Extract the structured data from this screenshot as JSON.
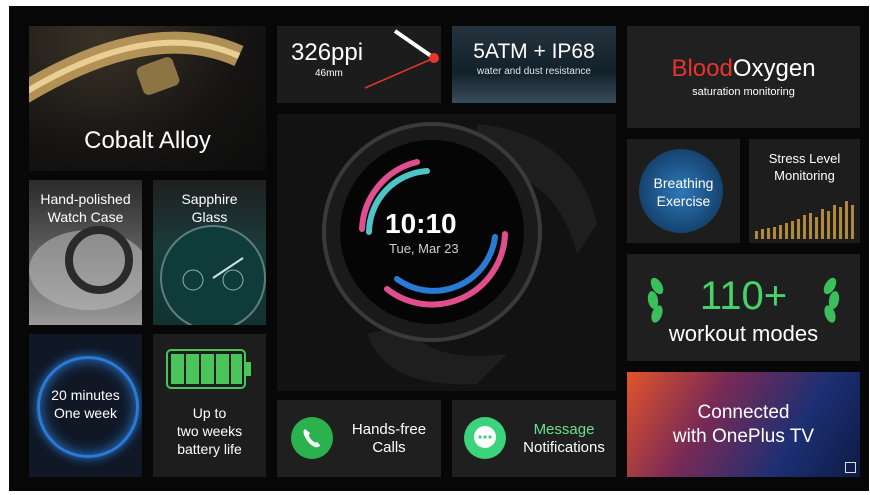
{
  "tiles": {
    "cobalt": "Cobalt Alloy",
    "ppi": {
      "value": "326ppi",
      "size": "46mm"
    },
    "atm": {
      "title": "5ATM + IP68",
      "subtitle": "water and dust resistance"
    },
    "blood": {
      "word1": "Blood",
      "word2": "Oxygen",
      "subtitle": "saturation monitoring"
    },
    "hand_polished": {
      "line1": "Hand-polished",
      "line2": "Watch Case"
    },
    "sapphire": {
      "line1": "Sapphire",
      "line2": "Glass"
    },
    "breathing": {
      "line1": "Breathing",
      "line2": "Exercise"
    },
    "stress": {
      "line1": "Stress Level",
      "line2": "Monitoring"
    },
    "workout": {
      "count": "110+",
      "label": "workout modes"
    },
    "charge": {
      "line1": "20 minutes",
      "line2": "One week"
    },
    "battery": {
      "line1": "Up to",
      "line2": "two weeks",
      "line3": "battery life"
    },
    "calls": {
      "line1": "Hands-free",
      "line2": "Calls"
    },
    "message": {
      "line1": "Message",
      "line2": "Notifications"
    },
    "tv": {
      "line1": "Connected",
      "line2": "with OnePlus TV"
    }
  },
  "watch": {
    "time": "10:10",
    "date": "Tue, Mar 23"
  },
  "colors": {
    "blood_red": "#e8332f",
    "green": "#2bb24c",
    "accent_blue": "#2a7bd6",
    "message_green": "#3bd37b"
  },
  "icons": [
    "phone-icon",
    "chat-icon",
    "laurel-left-icon",
    "laurel-right-icon",
    "battery-icon",
    "brand-mark-icon"
  ]
}
